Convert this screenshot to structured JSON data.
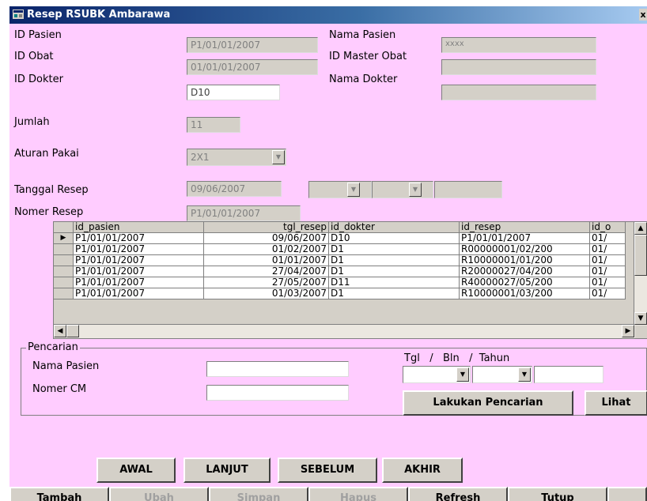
{
  "window": {
    "title": "Resep RSUBK Ambarawa",
    "close_label": "x"
  },
  "form": {
    "id_pasien_label": "ID Pasien",
    "id_pasien_value": "P1/01/01/2007",
    "nama_pasien_label": "Nama Pasien",
    "nama_pasien_value": "xxxx",
    "id_obat_label": "ID Obat",
    "id_obat_value": "01/01/01/2007",
    "id_master_obat_label": "ID Master Obat",
    "id_master_obat_value": "",
    "id_dokter_label": "ID Dokter",
    "id_dokter_value": "D10",
    "nama_dokter_label": "Nama Dokter",
    "nama_dokter_value": "",
    "jumlah_label": "Jumlah",
    "jumlah_value": "11",
    "aturan_pakai_label": "Aturan Pakai",
    "aturan_pakai_value": "2X1",
    "tanggal_resep_label": "Tanggal Resep",
    "tanggal_resep_value": "09/06/2007",
    "nomer_resep_label": "Nomer Resep",
    "nomer_resep_value": "P1/01/01/2007"
  },
  "grid": {
    "columns": [
      "id_pasien",
      "tgl_resep",
      "id_dokter",
      "id_resep",
      "id_o"
    ],
    "rows": [
      [
        "P1/01/01/2007",
        "09/06/2007",
        "D10",
        "P1/01/01/2007",
        "01/"
      ],
      [
        "P1/01/01/2007",
        "01/02/2007",
        "D1",
        "R00000001/02/200",
        "01/"
      ],
      [
        "P1/01/01/2007",
        "01/01/2007",
        "D1",
        "R10000001/01/200",
        "01/"
      ],
      [
        "P1/01/01/2007",
        "27/04/2007",
        "D1",
        "R20000027/04/200",
        "01/"
      ],
      [
        "P1/01/01/2007",
        "27/05/2007",
        "D11",
        "R40000027/05/200",
        "01/"
      ],
      [
        "P1/01/01/2007",
        "01/03/2007",
        "D1",
        "R10000001/03/200",
        "01/"
      ]
    ]
  },
  "search": {
    "legend": "Pencarian",
    "nama_pasien_label": "Nama Pasien",
    "nomer_cm_label": "Nomer CM",
    "date_label": "Tgl   /   Bln   /  Tahun",
    "search_button": "Lakukan Pencarian",
    "lihat_button": "Lihat"
  },
  "nav": {
    "awal": "AWAL",
    "lanjut": "LANJUT",
    "sebelum": "SEBELUM",
    "akhir": "AKHIR"
  },
  "actions": {
    "tambah": "Tambah",
    "ubah": "Ubah",
    "simpan": "Simpan",
    "hapus": "Hapus",
    "refresh": "Refresh",
    "tutup": "Tutup"
  },
  "colors": {
    "form_bg": "#ffccff",
    "title_bar": "#0a246a",
    "control": "#d4d0c8"
  }
}
